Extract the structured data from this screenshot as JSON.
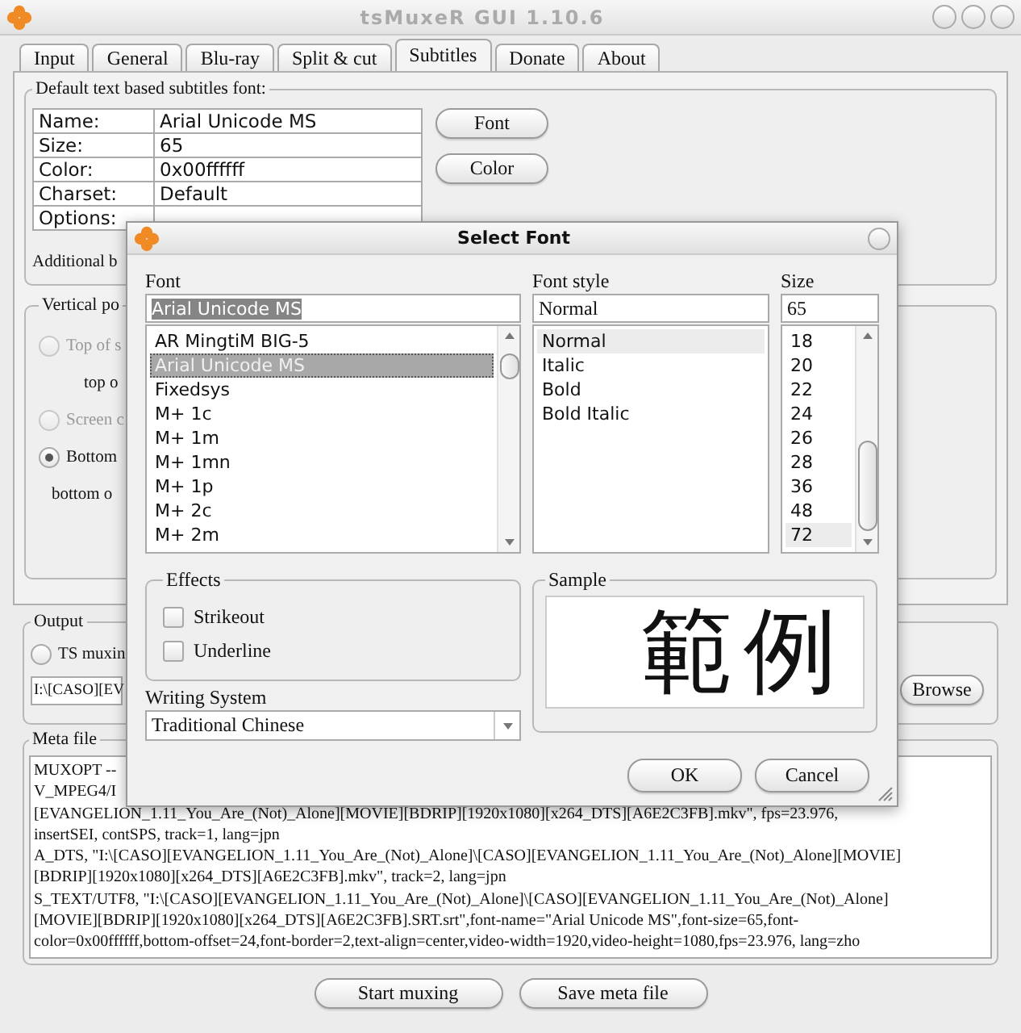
{
  "window": {
    "title": "tsMuxeR GUI 1.10.6"
  },
  "tabs": [
    {
      "label": "Input",
      "selected": false
    },
    {
      "label": "General",
      "selected": false
    },
    {
      "label": "Blu-ray",
      "selected": false
    },
    {
      "label": "Split & cut",
      "selected": false
    },
    {
      "label": "Subtitles",
      "selected": true
    },
    {
      "label": "Donate",
      "selected": false
    },
    {
      "label": "About",
      "selected": false
    }
  ],
  "font_group": {
    "title": "Default text based subtitles font:",
    "properties": [
      {
        "name": "Name:",
        "value": "Arial Unicode MS"
      },
      {
        "name": "Size:",
        "value": "65"
      },
      {
        "name": "Color:",
        "value": "0x00ffffff"
      },
      {
        "name": "Charset:",
        "value": "Default"
      },
      {
        "name": "Options:"
      }
    ],
    "buttons": [
      "Font",
      "Color"
    ],
    "additional": "Additional b"
  },
  "vertical_position": {
    "title": "Vertical po",
    "options": [
      {
        "kind": "radio",
        "label": "Top of s",
        "selected": false,
        "disabled": true
      },
      {
        "kind": "text",
        "label": "top o"
      },
      {
        "kind": "radio",
        "label": "Screen c",
        "selected": false,
        "disabled": true
      },
      {
        "kind": "radio",
        "label": "Bottom",
        "selected": true,
        "disabled": false
      },
      {
        "kind": "text",
        "label": "bottom o"
      }
    ]
  },
  "output": {
    "title": "Output",
    "option": {
      "label": "TS muxin",
      "selected": false
    },
    "path": "I:\\[CASO][EV",
    "browse": "Browse"
  },
  "meta_file": {
    "title": "Meta file",
    "lines": [
      "MUXOPT --",
      "V_MPEG4/I",
      "[EVANGELION_1.11_You_Are_(Not)_Alone][MOVIE][BDRIP][1920x1080][x264_DTS][A6E2C3FB].mkv\", fps=23.976,",
      "insertSEI, contSPS, track=1, lang=jpn",
      "A_DTS, \"I:\\[CASO][EVANGELION_1.11_You_Are_(Not)_Alone]\\[CASO][EVANGELION_1.11_You_Are_(Not)_Alone][MOVIE]",
      "[BDRIP][1920x1080][x264_DTS][A6E2C3FB].mkv\", track=2, lang=jpn",
      "S_TEXT/UTF8, \"I:\\[CASO][EVANGELION_1.11_You_Are_(Not)_Alone]\\[CASO][EVANGELION_1.11_You_Are_(Not)_Alone]",
      "[MOVIE][BDRIP][1920x1080][x264_DTS][A6E2C3FB].SRT.srt\",font-name=\"Arial Unicode MS\",font-size=65,font-",
      "color=0x00ffffff,bottom-offset=24,font-border=2,text-align=center,video-width=1920,video-height=1080,fps=23.976, lang=zho"
    ]
  },
  "actions": [
    "Start muxing",
    "Save meta file"
  ],
  "dialog": {
    "title": "Select Font",
    "font": {
      "label": "Font",
      "value": "Arial Unicode MS",
      "items": [
        {
          "label": "AR MingtiM BIG-5",
          "selected": false
        },
        {
          "label": "Arial Unicode MS",
          "selected": true
        },
        {
          "label": "Fixedsys",
          "selected": false
        },
        {
          "label": "M+ 1c",
          "selected": false
        },
        {
          "label": "M+ 1m",
          "selected": false
        },
        {
          "label": "M+ 1mn",
          "selected": false
        },
        {
          "label": "M+ 1p",
          "selected": false
        },
        {
          "label": "M+ 2c",
          "selected": false
        },
        {
          "label": "M+ 2m",
          "selected": false
        }
      ]
    },
    "style": {
      "label": "Font style",
      "value": "Normal",
      "items": [
        {
          "label": "Normal",
          "selected": true
        },
        {
          "label": "Italic",
          "selected": false
        },
        {
          "label": "Bold",
          "selected": false
        },
        {
          "label": "Bold Italic",
          "selected": false
        }
      ]
    },
    "size": {
      "label": "Size",
      "value": "65",
      "items": [
        {
          "label": "18",
          "selected": false
        },
        {
          "label": "20",
          "selected": false
        },
        {
          "label": "22",
          "selected": false
        },
        {
          "label": "24",
          "selected": false
        },
        {
          "label": "26",
          "selected": false
        },
        {
          "label": "28",
          "selected": false
        },
        {
          "label": "36",
          "selected": false
        },
        {
          "label": "48",
          "selected": false
        },
        {
          "label": "72",
          "selected": true
        }
      ]
    },
    "effects": {
      "title": "Effects",
      "options": [
        {
          "label": "Strikeout",
          "checked": false
        },
        {
          "label": "Underline",
          "checked": false
        }
      ]
    },
    "writing_system": {
      "label": "Writing System",
      "value": "Traditional Chinese"
    },
    "sample": {
      "title": "Sample",
      "text": "範例"
    },
    "buttons": [
      "OK",
      "Cancel"
    ]
  }
}
